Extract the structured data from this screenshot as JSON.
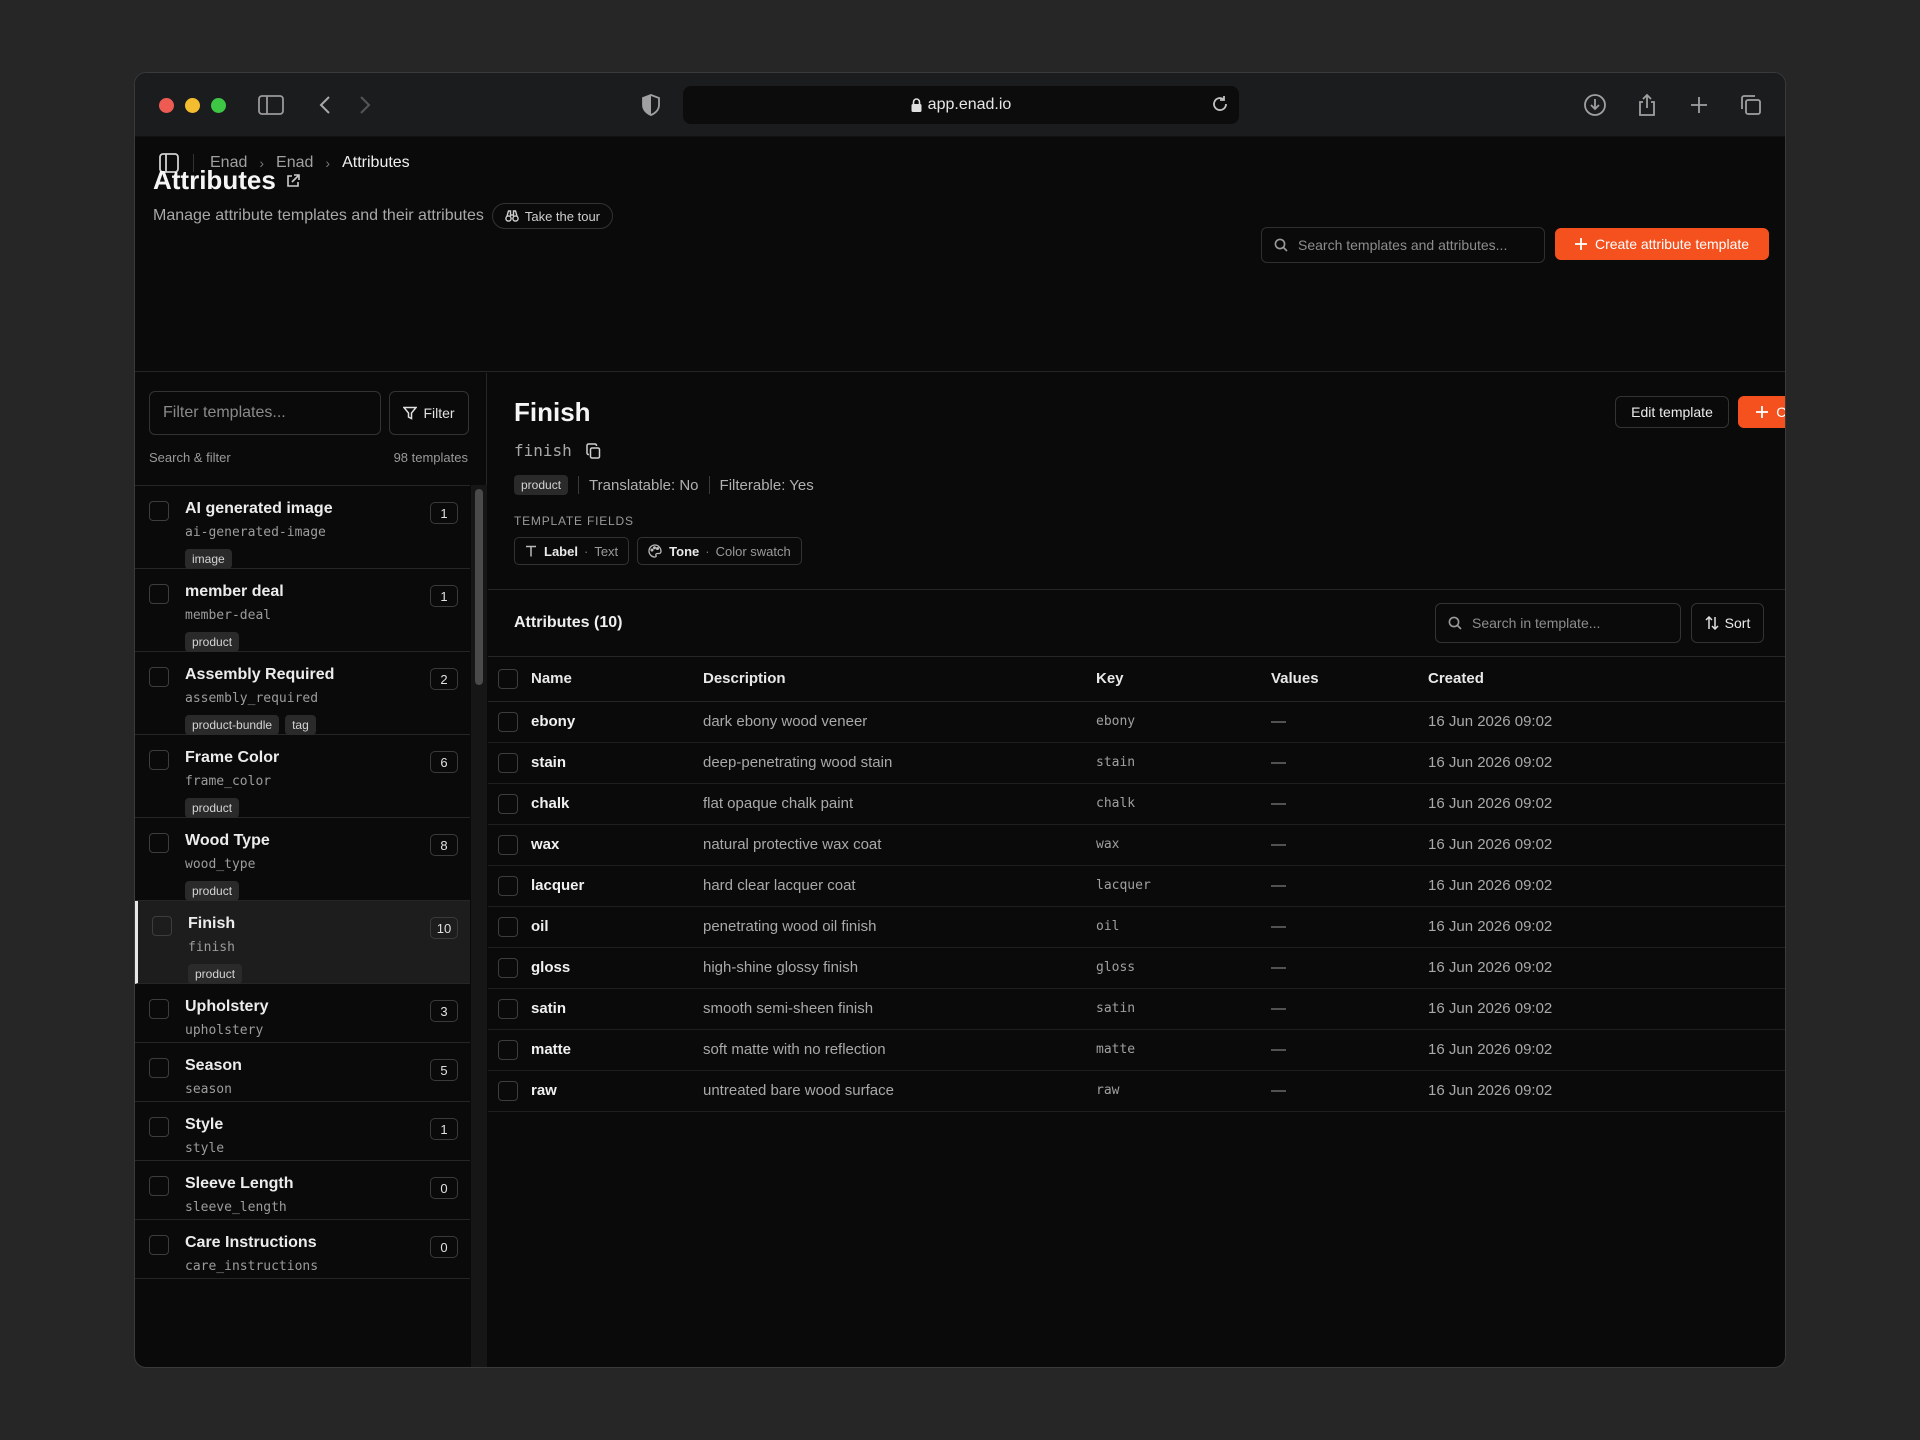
{
  "browser": {
    "url": "app.enad.io"
  },
  "breadcrumb": [
    "Enad",
    "Enad",
    "Attributes"
  ],
  "header": {
    "title": "Attributes",
    "subtitle": "Manage attribute templates and their attributes",
    "tour_label": "Take the tour",
    "search_placeholder": "Search templates and attributes...",
    "create_button": "Create attribute template"
  },
  "sidebar": {
    "filter_placeholder": "Filter templates...",
    "filter_button": "Filter",
    "search_filter_label": "Search & filter",
    "template_count": "98 templates",
    "templates": [
      {
        "name": "AI generated image",
        "key": "ai-generated-image",
        "count": "1",
        "tags": [
          "image"
        ]
      },
      {
        "name": "member deal",
        "key": "member-deal",
        "count": "1",
        "tags": [
          "product"
        ]
      },
      {
        "name": "Assembly Required",
        "key": "assembly_required",
        "count": "2",
        "tags": [
          "product-bundle",
          "tag"
        ]
      },
      {
        "name": "Frame Color",
        "key": "frame_color",
        "count": "6",
        "tags": [
          "product"
        ]
      },
      {
        "name": "Wood Type",
        "key": "wood_type",
        "count": "8",
        "tags": [
          "product"
        ]
      },
      {
        "name": "Finish",
        "key": "finish",
        "count": "10",
        "tags": [
          "product"
        ],
        "selected": true
      },
      {
        "name": "Upholstery",
        "key": "upholstery",
        "count": "3",
        "tags": []
      },
      {
        "name": "Season",
        "key": "season",
        "count": "5",
        "tags": []
      },
      {
        "name": "Style",
        "key": "style",
        "count": "1",
        "tags": []
      },
      {
        "name": "Sleeve Length",
        "key": "sleeve_length",
        "count": "0",
        "tags": []
      },
      {
        "name": "Care Instructions",
        "key": "care_instructions",
        "count": "0",
        "tags": []
      }
    ]
  },
  "detail": {
    "title": "Finish",
    "key": "finish",
    "tag": "product",
    "translatable": "Translatable: No",
    "filterable": "Filterable: Yes",
    "template_fields_label": "TEMPLATE FIELDS",
    "fields": [
      {
        "name": "Label",
        "type": "Text",
        "icon": "text-type-icon"
      },
      {
        "name": "Tone",
        "type": "Color swatch",
        "icon": "palette-icon"
      }
    ],
    "edit_button": "Edit template",
    "create_button": "Create attributes"
  },
  "attributes": {
    "title": "Attributes (10)",
    "search_placeholder": "Search in template...",
    "sort_label": "Sort",
    "columns": [
      "Name",
      "Description",
      "Key",
      "Values",
      "Created"
    ],
    "rows": [
      {
        "name": "ebony",
        "description": "dark ebony wood veneer",
        "key": "ebony",
        "values": "—",
        "created": "16 Jun 2026 09:02"
      },
      {
        "name": "stain",
        "description": "deep-penetrating wood stain",
        "key": "stain",
        "values": "—",
        "created": "16 Jun 2026 09:02"
      },
      {
        "name": "chalk",
        "description": "flat opaque chalk paint",
        "key": "chalk",
        "values": "—",
        "created": "16 Jun 2026 09:02"
      },
      {
        "name": "wax",
        "description": "natural protective wax coat",
        "key": "wax",
        "values": "—",
        "created": "16 Jun 2026 09:02"
      },
      {
        "name": "lacquer",
        "description": "hard clear lacquer coat",
        "key": "lacquer",
        "values": "—",
        "created": "16 Jun 2026 09:02"
      },
      {
        "name": "oil",
        "description": "penetrating wood oil finish",
        "key": "oil",
        "values": "—",
        "created": "16 Jun 2026 09:02"
      },
      {
        "name": "gloss",
        "description": "high-shine glossy finish",
        "key": "gloss",
        "values": "—",
        "created": "16 Jun 2026 09:02"
      },
      {
        "name": "satin",
        "description": "smooth semi-sheen finish",
        "key": "satin",
        "values": "—",
        "created": "16 Jun 2026 09:02"
      },
      {
        "name": "matte",
        "description": "soft matte with no reflection",
        "key": "matte",
        "values": "—",
        "created": "16 Jun 2026 09:02"
      },
      {
        "name": "raw",
        "description": "untreated bare wood surface",
        "key": "raw",
        "values": "—",
        "created": "16 Jun 2026 09:02"
      }
    ]
  },
  "colors": {
    "accent": "#f4511e",
    "background": "#0a0a0a"
  }
}
